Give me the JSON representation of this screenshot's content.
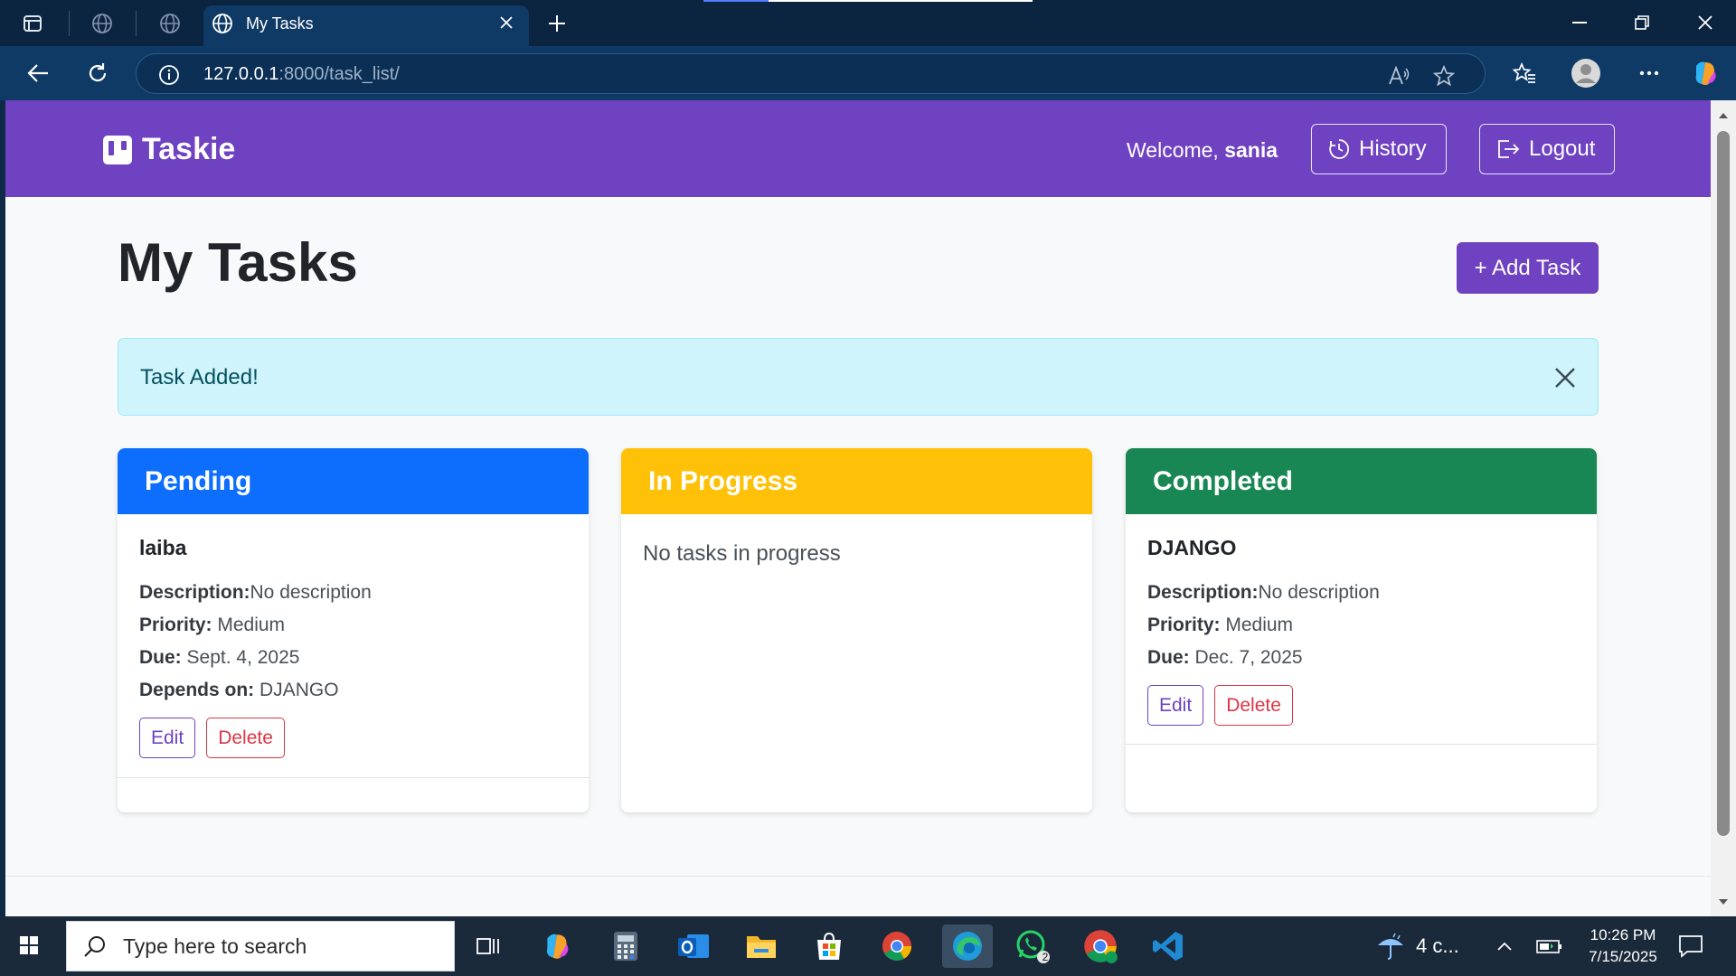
{
  "browser": {
    "tab_title": "My Tasks",
    "url_host": "127.0.0.1",
    "url_path": ":8000/task_list/"
  },
  "navbar": {
    "brand": "Taskie",
    "welcome_prefix": "Welcome,",
    "username": "sania",
    "history_label": "History",
    "logout_label": "Logout"
  },
  "main": {
    "title": "My Tasks",
    "add_task_label": "+ Add Task",
    "alert_text": "Task Added!"
  },
  "columns": {
    "pending": {
      "title": "Pending",
      "color": "#0d6efd",
      "task": {
        "name": "laiba",
        "description_label": "Description:",
        "description": "No description",
        "priority_label": "Priority:",
        "priority": "Medium",
        "due_label": "Due:",
        "due": "Sept. 4, 2025",
        "depends_label": "Depends on:",
        "depends": "DJANGO",
        "edit_label": "Edit",
        "delete_label": "Delete"
      }
    },
    "in_progress": {
      "title": "In Progress",
      "color": "#ffc107",
      "empty_text": "No tasks in progress"
    },
    "completed": {
      "title": "Completed",
      "color": "#198754",
      "task": {
        "name": "DJANGO",
        "description_label": "Description:",
        "description": "No description",
        "priority_label": "Priority:",
        "priority": "Medium",
        "due_label": "Due:",
        "due": "Dec. 7, 2025",
        "edit_label": "Edit",
        "delete_label": "Delete"
      }
    }
  },
  "taskbar": {
    "search_placeholder": "Type here to search",
    "weather": "4 c...",
    "whatsapp_badge": "2",
    "time": "10:26 PM",
    "date": "7/15/2025"
  },
  "colors": {
    "brand": "#6f42c1",
    "alert_bg": "#cff4fc",
    "danger": "#dc3545"
  }
}
